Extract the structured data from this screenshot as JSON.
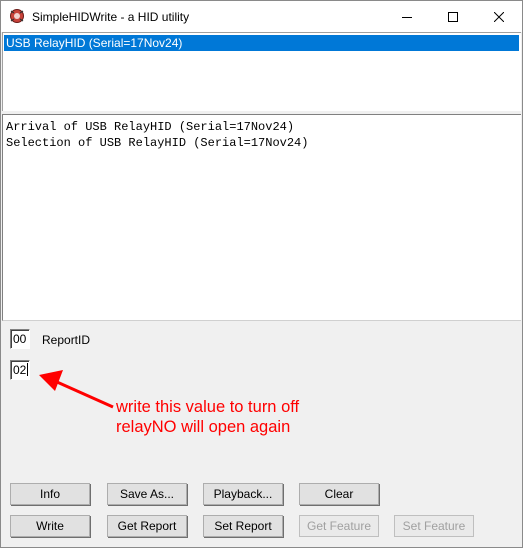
{
  "window": {
    "title": "SimpleHIDWrite - a HID utility",
    "minimize_icon": "minimize-icon",
    "maximize_icon": "maximize-icon",
    "close_icon": "close-icon"
  },
  "device_list": {
    "items": [
      {
        "label": "USB RelayHID (Serial=17Nov24)",
        "selected": true
      }
    ]
  },
  "log": {
    "lines": [
      "Arrival of USB RelayHID (Serial=17Nov24)",
      "Selection of USB RelayHID (Serial=17Nov24)"
    ]
  },
  "report": {
    "id_value": "00",
    "id_label": "ReportID",
    "data_value": "02"
  },
  "annotation": {
    "line1": "write this value to turn off",
    "line2": "relayNO will open again",
    "color": "#ff0000"
  },
  "buttons": {
    "info": "Info",
    "save_as": "Save As...",
    "playback": "Playback...",
    "clear": "Clear",
    "write": "Write",
    "get_report": "Get Report",
    "set_report": "Set Report",
    "get_feature": "Get Feature",
    "set_feature": "Set Feature"
  },
  "colors": {
    "selection": "#0078d7",
    "disabled_text": "#a0a0a0"
  }
}
